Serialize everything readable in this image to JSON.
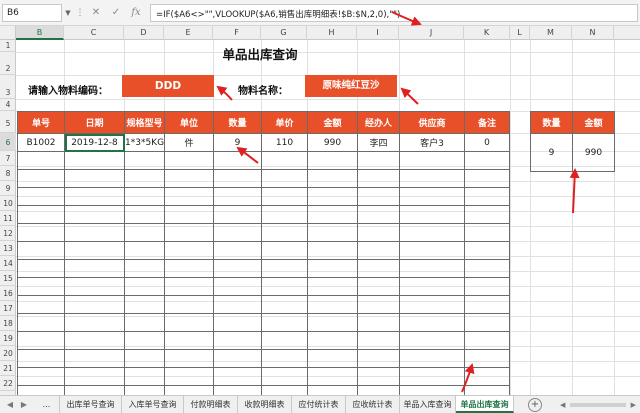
{
  "formula_bar": {
    "name_box": "B6",
    "formula": "=IF($A6<>\"\",VLOOKUP($A6,销售出库明细表!$B:$N,2,0),\"\")",
    "cancel_glyph": "✕",
    "enter_glyph": "✓",
    "fx_label": "fx"
  },
  "columns": [
    "B",
    "C",
    "D",
    "E",
    "F",
    "G",
    "H",
    "I",
    "J",
    "K",
    "L",
    "M",
    "N"
  ],
  "rows": [
    "1",
    "2",
    "3",
    "4",
    "5",
    "6",
    "7",
    "8",
    "9",
    "10",
    "11",
    "12",
    "13",
    "14",
    "15",
    "16",
    "17",
    "18",
    "19",
    "20",
    "21",
    "22"
  ],
  "title": "单品出库查询",
  "code_label": "请输入物料编码：",
  "code_value": "DDD",
  "name_label": "物料名称：",
  "name_value": "原味纯红豆沙",
  "main_table": {
    "headers": [
      "单号",
      "日期",
      "规格型号",
      "单位",
      "数量",
      "单价",
      "金额",
      "经办人",
      "供应商",
      "备注"
    ],
    "first_row": [
      "B1002",
      "2019-12-8",
      "1*3*5KG",
      "件",
      "9",
      "110",
      "990",
      "李四",
      "客户3",
      "0"
    ]
  },
  "summary_table": {
    "headers": [
      "数量",
      "金额"
    ],
    "values": [
      "9",
      "990"
    ]
  },
  "sheet_tabs": {
    "ellipsis": "...",
    "tabs": [
      "出库单号查询",
      "入库单号查询",
      "付款明细表",
      "收款明细表",
      "应付统计表",
      "应收统计表",
      "单品入库查询",
      "单品出库查询"
    ],
    "active": "单品出库查询"
  },
  "colors": {
    "accent": "#e8502a",
    "excel_green": "#217346",
    "arrow_red": "#e02020"
  }
}
